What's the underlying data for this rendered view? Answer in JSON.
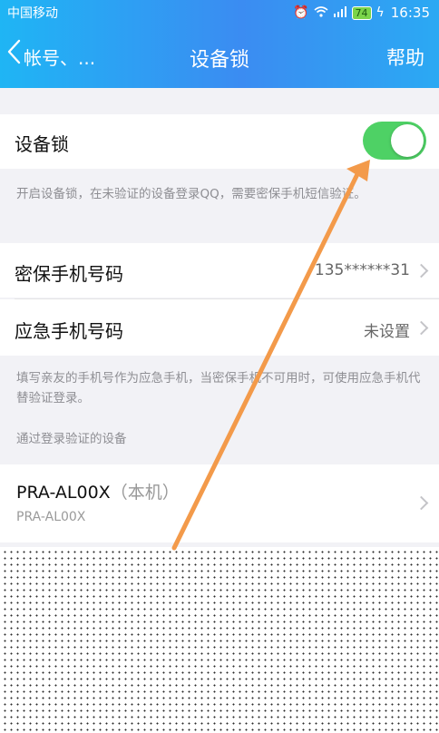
{
  "status_bar": {
    "carrier": "中国移动",
    "battery": "74",
    "time": "16:35",
    "icons": [
      "alarm-icon",
      "wifi-icon",
      "signal-icon",
      "battery-icon",
      "charging-icon"
    ]
  },
  "nav": {
    "back_label": "帐号、...",
    "title": "设备锁",
    "help": "帮助"
  },
  "device_lock": {
    "label": "设备锁",
    "toggle_on": true,
    "hint": "开启设备锁，在未验证的设备登录QQ，需要密保手机短信验证。"
  },
  "phones": {
    "security_label": "密保手机号码",
    "security_value": "135******31",
    "emergency_label": "应急手机号码",
    "emergency_value": "未设置",
    "hint": "填写亲友的手机号作为应急手机，当密保手机不可用时，可使用应急手机代替验证登录。"
  },
  "devices": {
    "section_title": "通过登录验证的设备",
    "items": [
      {
        "name": "PRA-AL00X",
        "suffix": "（本机）",
        "model": "PRA-AL00X"
      }
    ]
  },
  "colors": {
    "header_gradient_start": "#1fb5f4",
    "header_gradient_end": "#3b8cf2",
    "toggle_on": "#4ed165",
    "annotation_arrow": "#f39a4a"
  }
}
